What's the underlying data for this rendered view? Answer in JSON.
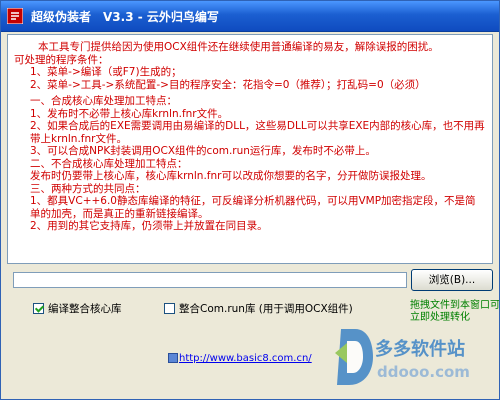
{
  "window": {
    "title": "超级伪装者　V3.3 - 云外归鸟编写"
  },
  "main": {
    "lines": [
      "本工具专门提供给因为使用OCX组件还在继续使用普通编译的易友，解除误报的困扰。",
      "可处理的程序条件：",
      "1、菜单->编译（或F7)生成的；",
      "2、菜单->工具->系统配置->目的程序安全：花指令=0（推荐）；打乱码=0（必须）",
      "一、合成核心库处理加工特点：",
      "1、发布时不必带上核心库krnln.fnr文件。",
      "2、如果合成后的EXE需要调用由易编译的DLL，这些易DLL可以共享EXE内部的核心库，也不用再带上krnln.fnr文件。",
      "3、可以合成NPK封装调用OCX组件的com.run运行库，发布时不必带上。",
      "二、不合成核心库处理加工特点：",
      "发布时仍要带上核心库，核心库krnln.fnr可以改成你想要的名字，分开做防误报处理。",
      "三、两种方式的共同点：",
      "1、都具VC++6.0静态库编译的特征，可反编译分析机器代码，可以用VMP加密指定段，不是简单的加壳，而是真正的重新链接编译。",
      "2、用到的其它支持库，仍须带上并放置在同目录。"
    ]
  },
  "controls": {
    "path_value": "",
    "browse_label": "浏览(B)...",
    "checkbox1_label": "编译整合核心库",
    "checkbox1_checked": true,
    "checkbox2_label": "整合Com.run库  (用于调用OCX组件)",
    "checkbox2_checked": false,
    "side_note": "拖拽文件到本窗口可立即处理转化",
    "link_text": "http://www.basic8.com.cn/"
  },
  "watermark": {
    "brand": "多多软件站",
    "url": "ddooo.com"
  },
  "colors": {
    "title_bar": "#1b5fd1",
    "red_text": "#d00000",
    "green_text": "#008000",
    "link": "#0000ee"
  }
}
